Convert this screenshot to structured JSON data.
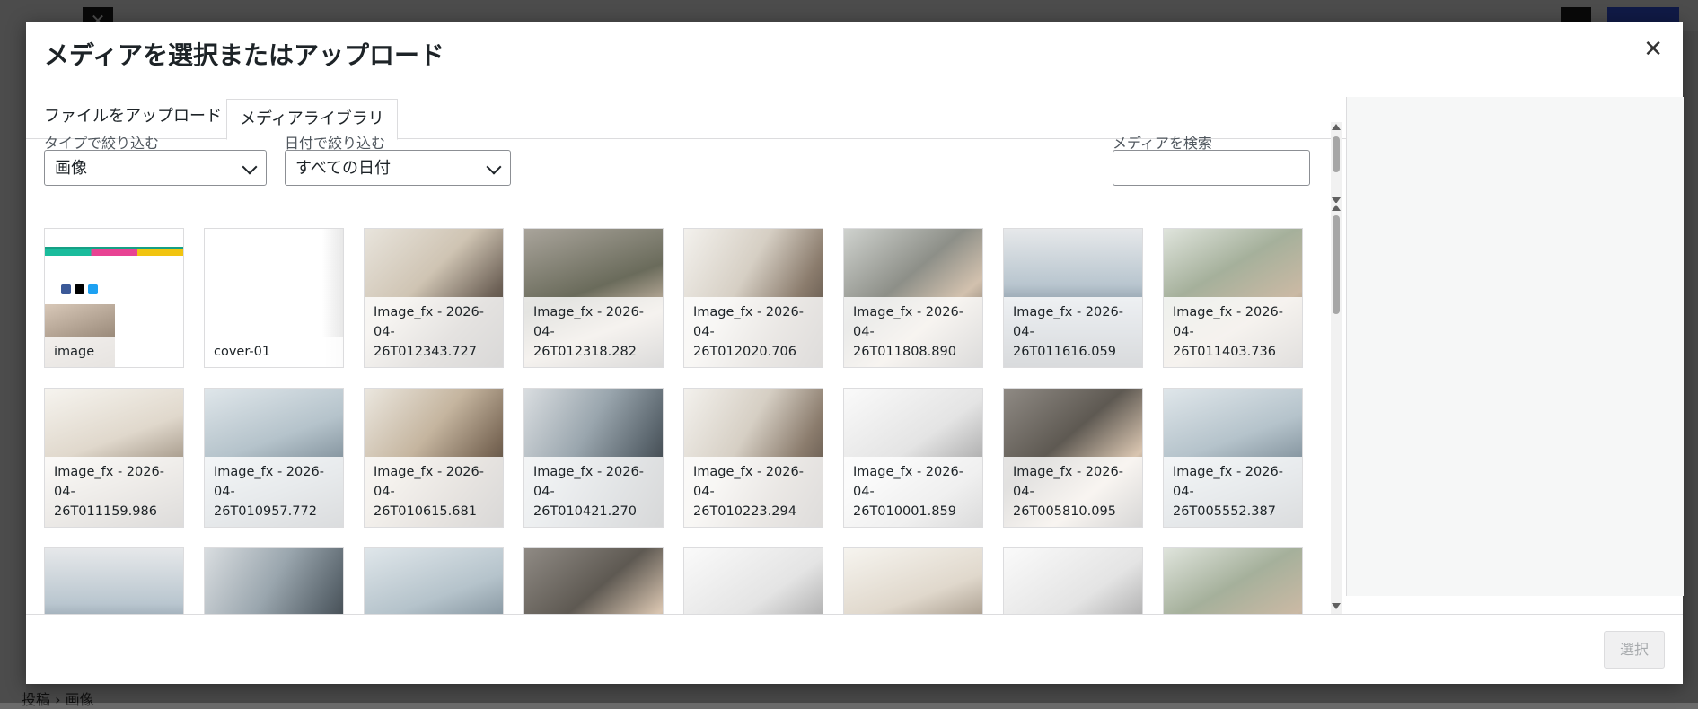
{
  "modal": {
    "title": "メディアを選択またはアップロード",
    "close_icon": "close-icon",
    "tabs": [
      {
        "label": "ファイルをアップロード",
        "active": false
      },
      {
        "label": "メディアライブラリ",
        "active": true
      }
    ]
  },
  "filters": {
    "type_label": "タイプで絞り込む",
    "type_value": "画像",
    "date_label": "日付で絞り込む",
    "date_value": "すべての日付",
    "search_label": "メディアを検索",
    "search_value": ""
  },
  "grid": {
    "items": [
      {
        "caption": "image",
        "style": "site"
      },
      {
        "caption": "cover-01",
        "style": "cover"
      },
      {
        "caption": "Image_fx - 2026-04-26T012343.727",
        "style": "p1"
      },
      {
        "caption": "Image_fx - 2026-04-26T012318.282",
        "style": "p2"
      },
      {
        "caption": "Image_fx - 2026-04-26T012020.706",
        "style": "p3"
      },
      {
        "caption": "Image_fx - 2026-04-26T011808.890",
        "style": "p4"
      },
      {
        "caption": "Image_fx - 2026-04-26T011616.059",
        "style": "p5"
      },
      {
        "caption": "Image_fx - 2026-04-26T011403.736",
        "style": "p6"
      },
      {
        "caption": "Image_fx - 2026-04-26T011159.986",
        "style": "p8"
      },
      {
        "caption": "Image_fx - 2026-04-26T010957.772",
        "style": "p12"
      },
      {
        "caption": "Image_fx - 2026-04-26T010615.681",
        "style": "p7"
      },
      {
        "caption": "Image_fx - 2026-04-26T010421.270",
        "style": "p9"
      },
      {
        "caption": "Image_fx - 2026-04-26T010223.294",
        "style": "p3"
      },
      {
        "caption": "Image_fx - 2026-04-26T010001.859",
        "style": "p10"
      },
      {
        "caption": "Image_fx - 2026-04-26T005810.095",
        "style": "p11"
      },
      {
        "caption": "Image_fx - 2026-04-26T005552.387",
        "style": "p12"
      },
      {
        "caption": "",
        "style": "p5"
      },
      {
        "caption": "",
        "style": "p9"
      },
      {
        "caption": "",
        "style": "p12"
      },
      {
        "caption": "",
        "style": "p11"
      },
      {
        "caption": "",
        "style": "p10"
      },
      {
        "caption": "",
        "style": "p8"
      },
      {
        "caption": "",
        "style": "p10"
      },
      {
        "caption": "",
        "style": "p6"
      }
    ]
  },
  "footer": {
    "select_label": "選択"
  },
  "background": {
    "breadcrumb": "投稿 › 画像"
  }
}
